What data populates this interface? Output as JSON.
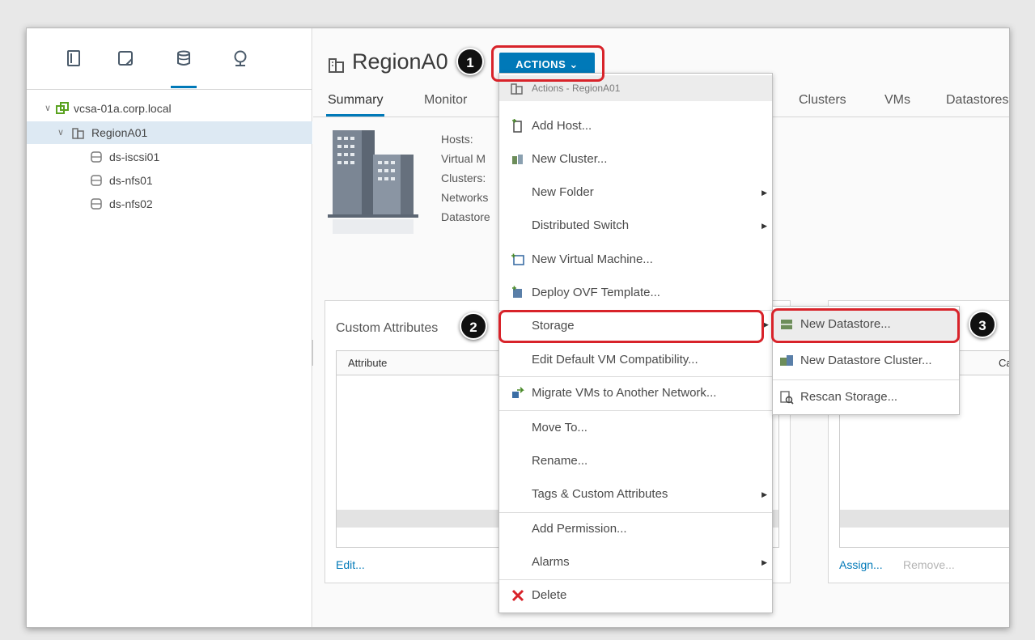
{
  "navigator": {
    "tabs": [
      {
        "icon": "hosts-and-clusters-icon"
      },
      {
        "icon": "vms-and-templates-icon"
      },
      {
        "icon": "storage-icon"
      },
      {
        "icon": "networking-icon"
      }
    ],
    "tree": {
      "vcenter": "vcsa-01a.corp.local",
      "datacenter": "RegionA01",
      "datastores": [
        "ds-iscsi01",
        "ds-nfs01",
        "ds-nfs02"
      ]
    }
  },
  "header": {
    "title": "RegionA0",
    "actions_label": "ACTIONS",
    "actions_chevron": "⌄"
  },
  "tabs": [
    "Summary",
    "Monitor",
    "Clusters",
    "VMs",
    "Datastores"
  ],
  "summary": {
    "labels": [
      "Hosts:",
      "Virtual M",
      "Clusters:",
      "Networks",
      "Datastore"
    ]
  },
  "custom_attributes": {
    "title": "Custom Attributes",
    "column": "Attribute",
    "edit_link": "Edit..."
  },
  "tags_panel": {
    "column_partial": "Catego",
    "assign_link": "Assign...",
    "remove_link": "Remove..."
  },
  "menu": {
    "header": "Actions - RegionA01",
    "items": [
      {
        "label": "Add Host...",
        "icon": "add-host-icon",
        "submenu": false
      },
      {
        "label": "New Cluster...",
        "icon": "new-cluster-icon",
        "submenu": false
      },
      {
        "label": "New Folder",
        "icon": "",
        "submenu": true
      },
      {
        "label": "Distributed Switch",
        "icon": "",
        "submenu": true
      },
      {
        "label": "New Virtual Machine...",
        "icon": "new-vm-icon",
        "submenu": false
      },
      {
        "label": "Deploy OVF Template...",
        "icon": "deploy-ovf-icon",
        "submenu": false
      },
      {
        "label": "Storage",
        "icon": "",
        "submenu": true
      },
      {
        "label": "Edit Default VM Compatibility...",
        "icon": "",
        "submenu": false
      },
      {
        "label": "Migrate VMs to Another Network...",
        "icon": "migrate-vms-icon",
        "submenu": false
      },
      {
        "label": "Move To...",
        "icon": "",
        "submenu": false
      },
      {
        "label": "Rename...",
        "icon": "",
        "submenu": false
      },
      {
        "label": "Tags & Custom Attributes",
        "icon": "",
        "submenu": true
      },
      {
        "label": "Add Permission...",
        "icon": "",
        "submenu": false
      },
      {
        "label": "Alarms",
        "icon": "",
        "submenu": true
      },
      {
        "label": "Delete",
        "icon": "delete-icon",
        "submenu": false
      }
    ]
  },
  "storage_submenu": {
    "items": [
      {
        "label": "New Datastore...",
        "icon": "new-datastore-icon"
      },
      {
        "label": "New Datastore Cluster...",
        "icon": "new-datastore-cluster-icon"
      },
      {
        "label": "Rescan Storage...",
        "icon": "rescan-storage-icon"
      }
    ]
  },
  "callouts": [
    "1",
    "2",
    "3"
  ],
  "colors": {
    "accent": "#0079b8",
    "highlight_box": "#d8232a",
    "selection": "#dde9f3"
  }
}
